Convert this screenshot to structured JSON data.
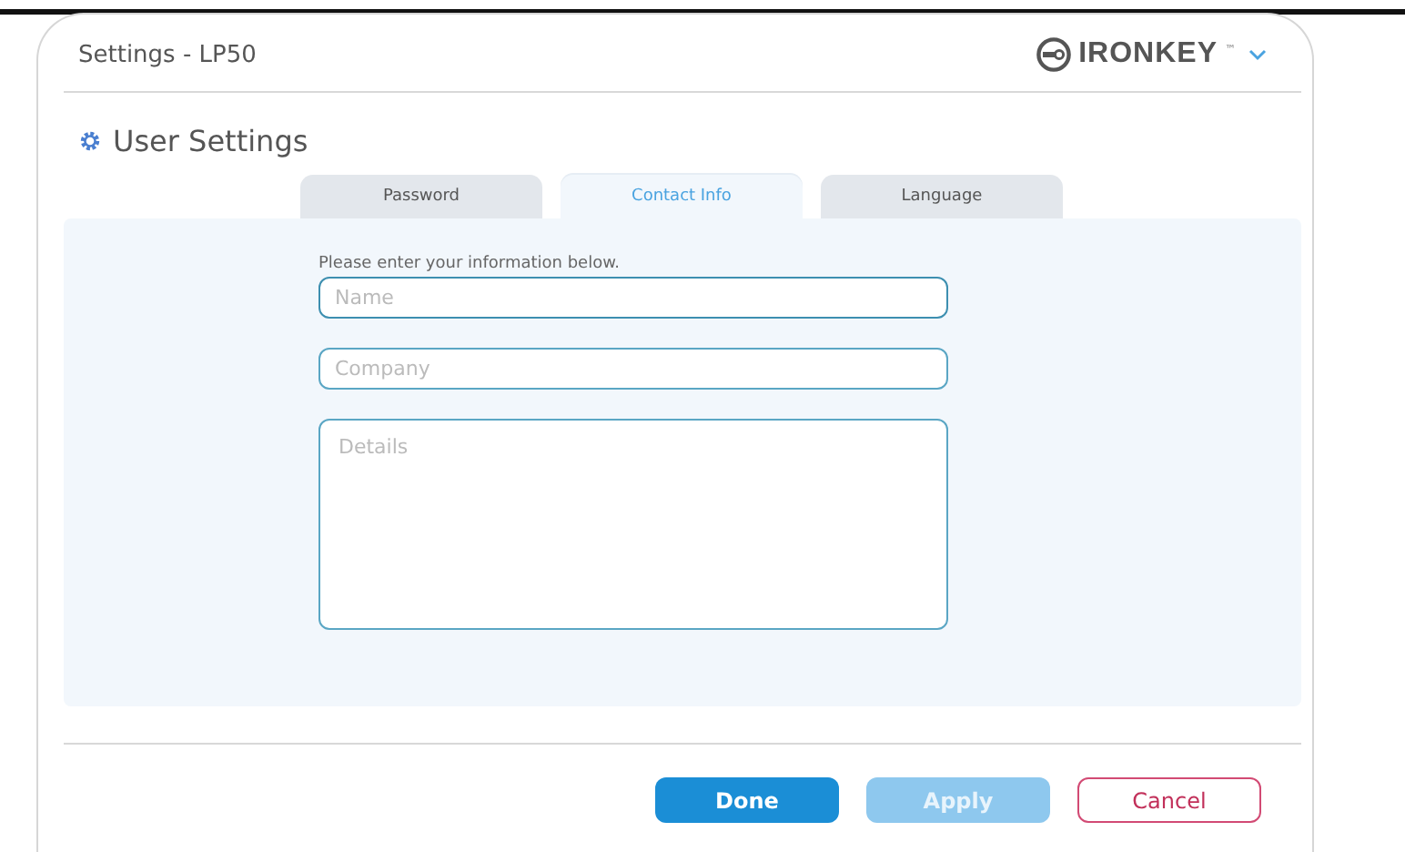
{
  "window": {
    "title": "Settings - LP50"
  },
  "brand": {
    "name": "IRONKEY",
    "mark": "™"
  },
  "section": {
    "title": "User Settings"
  },
  "tabs": [
    {
      "label": "Password",
      "selected": false
    },
    {
      "label": "Contact Info",
      "selected": true
    },
    {
      "label": "Language",
      "selected": false
    }
  ],
  "form": {
    "intro": "Please enter your information below.",
    "fields": [
      {
        "kind": "line",
        "placeholder": "Name",
        "focused": true
      },
      {
        "kind": "line",
        "placeholder": "Company",
        "focused": false
      },
      {
        "kind": "area",
        "placeholder": "Details",
        "focused": false
      }
    ]
  },
  "buttons": [
    {
      "label": "Done",
      "kind": "primary",
      "disabled": false
    },
    {
      "label": "Apply",
      "kind": "primary",
      "disabled": true
    },
    {
      "label": "Cancel",
      "kind": "cancel",
      "disabled": false
    }
  ]
}
